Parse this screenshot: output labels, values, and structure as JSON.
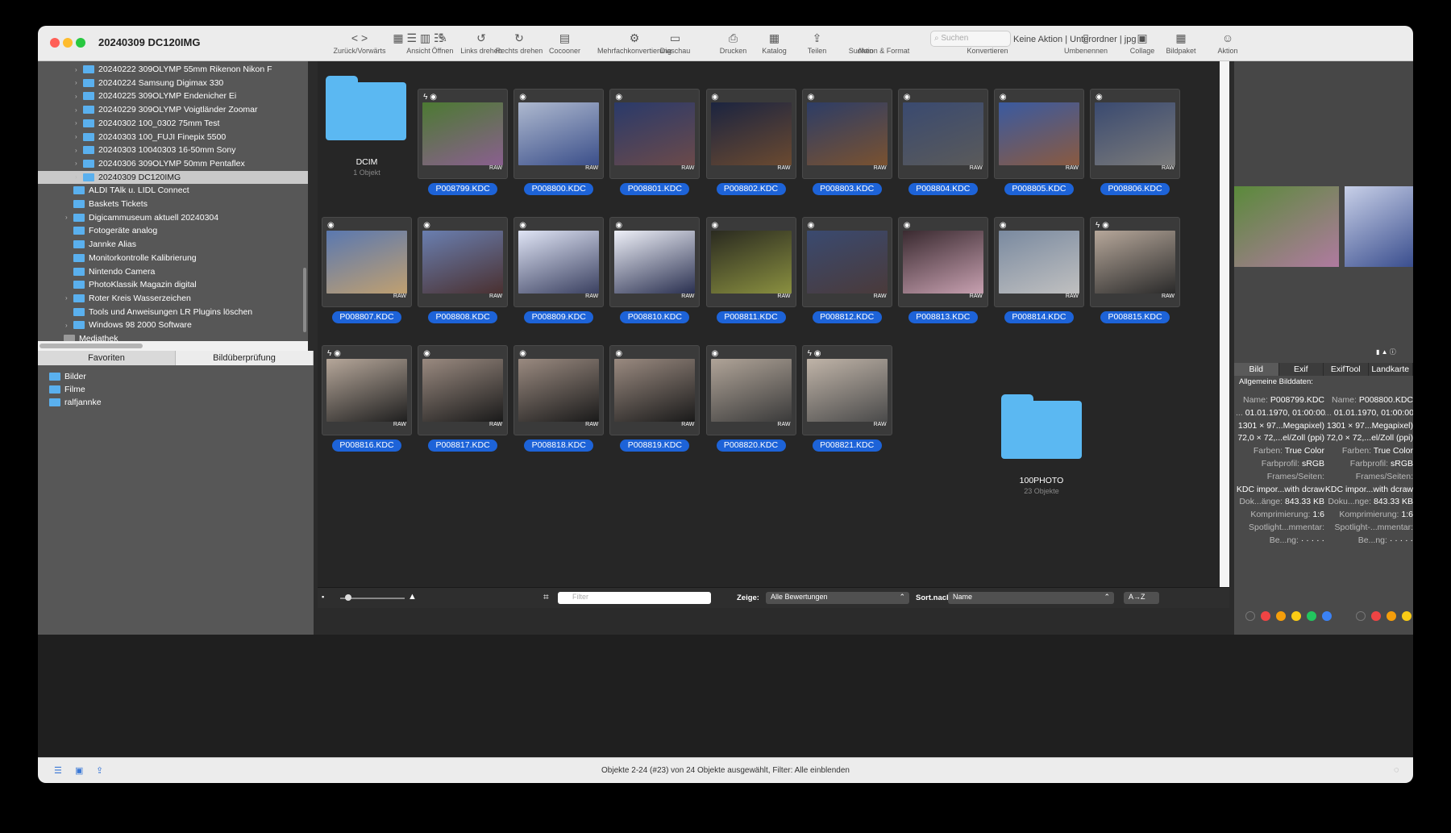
{
  "window": {
    "title": "20240309 DC120IMG"
  },
  "toolbar": {
    "items": [
      {
        "icon": "<  >",
        "label": "Zurück/Vorwärts"
      },
      {
        "icon": "▦ ☰ ▥ ☷",
        "label": "Ansicht"
      },
      {
        "icon": "✎",
        "label": "Öffnen"
      },
      {
        "icon": "↺",
        "label": "Links drehen"
      },
      {
        "icon": "↻",
        "label": "Rechts drehen"
      },
      {
        "icon": "▤",
        "label": "Cocooner"
      },
      {
        "icon": "⚙",
        "label": "Mehrfachkonvertierung"
      },
      {
        "icon": "▭",
        "label": "Diaschau"
      },
      {
        "icon": "⎙",
        "label": "Drucken"
      },
      {
        "icon": "▦",
        "label": "Katalog"
      },
      {
        "icon": "⇪",
        "label": "Teilen"
      },
      {
        "icon": "",
        "label": "Suchen"
      },
      {
        "icon": "",
        "label": "Aktion & Format"
      },
      {
        "icon": "⇄",
        "label": "Konvertieren"
      },
      {
        "icon": "▯",
        "label": "Umbenennen"
      },
      {
        "icon": "▣",
        "label": "Collage"
      },
      {
        "icon": "▦",
        "label": "Bildpaket"
      },
      {
        "icon": "☺",
        "label": "Aktion"
      }
    ],
    "search_placeholder": "Suchen",
    "action_value": "Keine Aktion | Unterordner | jpg"
  },
  "sidebar": {
    "tree": [
      {
        "label": "20240222 309OLYMP 55mm Rikenon Nikon F",
        "selected": false
      },
      {
        "label": "20240224 Samsung Digimax 330",
        "selected": false
      },
      {
        "label": "20240225 309OLYMP Endenicher Ei",
        "selected": false
      },
      {
        "label": "20240229 309OLYMP Voigtländer Zoomar",
        "selected": false
      },
      {
        "label": "20240302 100_0302 75mm Test",
        "selected": false
      },
      {
        "label": "20240303 100_FUJI Finepix 5500",
        "selected": false
      },
      {
        "label": "20240303 10040303 16-50mm Sony",
        "selected": false
      },
      {
        "label": "20240306 309OLYMP 50mm Pentaflex",
        "selected": false
      },
      {
        "label": "20240309 DC120IMG",
        "selected": true
      },
      {
        "label": "ALDI TAlk u. LIDL Connect",
        "selected": false
      },
      {
        "label": "Baskets Tickets",
        "selected": false
      },
      {
        "label": "Digicammuseum aktuell 20240304",
        "selected": false
      },
      {
        "label": "Fotogeräte analog",
        "selected": false
      },
      {
        "label": "Jannke Alias",
        "selected": false
      },
      {
        "label": "Monitorkontrolle Kalibrierung",
        "selected": false
      },
      {
        "label": "Nintendo Camera",
        "selected": false
      },
      {
        "label": "PhotoKlassik Magazin digital",
        "selected": false
      },
      {
        "label": "Roter Kreis Wasserzeichen",
        "selected": false
      },
      {
        "label": "Tools und Anweisungen LR Plugins löschen",
        "selected": false
      },
      {
        "label": "Windows 98 2000 Software",
        "selected": false
      },
      {
        "label": "Mediathek",
        "selected": false
      }
    ],
    "tabs": [
      "Favoriten",
      "Bildüberprüfung"
    ],
    "favorites": [
      "Bilder",
      "Filme",
      "ralfjannke"
    ]
  },
  "grid": {
    "folders": [
      {
        "name": "DCIM",
        "count": "1 Objekt"
      },
      {
        "name": "100PHOTO",
        "count": "23 Objekte"
      }
    ],
    "raw_label": "RAW",
    "images": [
      {
        "name": "P008799.KDC",
        "flash": true,
        "c1": "#4c7a32",
        "c2": "#8a5f8f"
      },
      {
        "name": "P008800.KDC",
        "flash": false,
        "c1": "#aeb9cf",
        "c2": "#3b4f8a"
      },
      {
        "name": "P008801.KDC",
        "flash": false,
        "c1": "#2a3a6a",
        "c2": "#6b4a4a"
      },
      {
        "name": "P008802.KDC",
        "flash": false,
        "c1": "#1b2440",
        "c2": "#6b4a30"
      },
      {
        "name": "P008803.KDC",
        "flash": false,
        "c1": "#2d3d66",
        "c2": "#7a5230"
      },
      {
        "name": "P008804.KDC",
        "flash": false,
        "c1": "#3a4a70",
        "c2": "#5a5a5a"
      },
      {
        "name": "P008805.KDC",
        "flash": false,
        "c1": "#3a5aa0",
        "c2": "#8a5a40"
      },
      {
        "name": "P008806.KDC",
        "flash": false,
        "c1": "#3a4a70",
        "c2": "#7a7a7a"
      },
      {
        "name": "P008807.KDC",
        "flash": false,
        "c1": "#5a78b0",
        "c2": "#c0a070"
      },
      {
        "name": "P008808.KDC",
        "flash": false,
        "c1": "#6a7fb0",
        "c2": "#4a3030"
      },
      {
        "name": "P008809.KDC",
        "flash": false,
        "c1": "#dfe4f5",
        "c2": "#3a4060"
      },
      {
        "name": "P008810.KDC",
        "flash": false,
        "c1": "#eef0f8",
        "c2": "#2a3050"
      },
      {
        "name": "P008811.KDC",
        "flash": false,
        "c1": "#2a2a20",
        "c2": "#8a9040"
      },
      {
        "name": "P008812.KDC",
        "flash": false,
        "c1": "#3a4a70",
        "c2": "#4a3a3a"
      },
      {
        "name": "P008813.KDC",
        "flash": false,
        "c1": "#3a2a30",
        "c2": "#c7a0b0"
      },
      {
        "name": "P008814.KDC",
        "flash": false,
        "c1": "#7a8aa0",
        "c2": "#c0c0c0"
      },
      {
        "name": "P008815.KDC",
        "flash": true,
        "c1": "#b6a79a",
        "c2": "#2a2a2a"
      },
      {
        "name": "P008816.KDC",
        "flash": true,
        "c1": "#b6a79a",
        "c2": "#1f1f1f"
      },
      {
        "name": "P008817.KDC",
        "flash": false,
        "c1": "#9a8a80",
        "c2": "#1a1a1a"
      },
      {
        "name": "P008818.KDC",
        "flash": false,
        "c1": "#9a8a80",
        "c2": "#1a1a1a"
      },
      {
        "name": "P008819.KDC",
        "flash": false,
        "c1": "#9a8a80",
        "c2": "#1a1a1a"
      },
      {
        "name": "P008820.KDC",
        "flash": false,
        "c1": "#b0a498",
        "c2": "#3a3a3a"
      },
      {
        "name": "P008821.KDC",
        "flash": true,
        "c1": "#c0b4a8",
        "c2": "#4a4a4a"
      }
    ]
  },
  "gridbar": {
    "filter_placeholder": "Filter",
    "show_label": "Zeige:",
    "show_value": "Alle Bewertungen",
    "sort_label": "Sort.nach:",
    "sort_value": "Name",
    "order_value": "A→Z"
  },
  "right_panel": {
    "preview_colors": [
      [
        "#5a8a3a",
        "#b07aa0"
      ],
      [
        "#c8d0e8",
        "#3a4e8e"
      ]
    ],
    "tabs": [
      "Bild",
      "Exif",
      "ExifTool",
      "Landkarte"
    ],
    "section": "Allgemeine Bilddaten:",
    "meta_left": [
      {
        "k": "Name:",
        "v": "P008799.KDC"
      },
      {
        "k": "...",
        "v": "01.01.1970, 01:00:00"
      },
      {
        "k": "",
        "v": "1301 × 97...Megapixel)"
      },
      {
        "k": "",
        "v": "72,0 × 72,...el/Zoll (ppi)"
      },
      {
        "k": "Farben:",
        "v": "True Color"
      },
      {
        "k": "Farbprofil:",
        "v": "sRGB"
      },
      {
        "k": "Frames/Seiten:",
        "v": ""
      },
      {
        "k": "",
        "v": "KDC impor...with dcraw"
      },
      {
        "k": "Dok...änge:",
        "v": "843.33 KB"
      },
      {
        "k": "Komprimierung:",
        "v": "1:6"
      },
      {
        "k": "Spotlight...mmentar:",
        "v": ""
      },
      {
        "k": "Be...ng:",
        "v": "·  ·  ·  ·  ·"
      }
    ],
    "meta_right": [
      {
        "k": "Name:",
        "v": "P008800.KDC"
      },
      {
        "k": "...",
        "v": "01.01.1970, 01:00:00"
      },
      {
        "k": "",
        "v": "1301 × 97...Megapixel)"
      },
      {
        "k": "",
        "v": "72,0 × 72,...el/Zoll (ppi)"
      },
      {
        "k": "Farben:",
        "v": "True Color"
      },
      {
        "k": "Farbprofil:",
        "v": "sRGB"
      },
      {
        "k": "Frames/Seiten:",
        "v": ""
      },
      {
        "k": "",
        "v": "KDC impor...with dcraw"
      },
      {
        "k": "Doku...nge:",
        "v": "843.33 KB"
      },
      {
        "k": "Komprimierung:",
        "v": "1:6"
      },
      {
        "k": "Spotlight-...mmentar:",
        "v": ""
      },
      {
        "k": "Be...ng:",
        "v": "·  ·  ·  ·  ·"
      }
    ],
    "label_colors": [
      "#ef4444",
      "#f59e0b",
      "#facc15",
      "#22c55e",
      "#3b82f6"
    ]
  },
  "status": {
    "text": "Objekte 2-24 (#23) von 24 Objekte ausgewählt, Filter: Alle einblenden"
  }
}
